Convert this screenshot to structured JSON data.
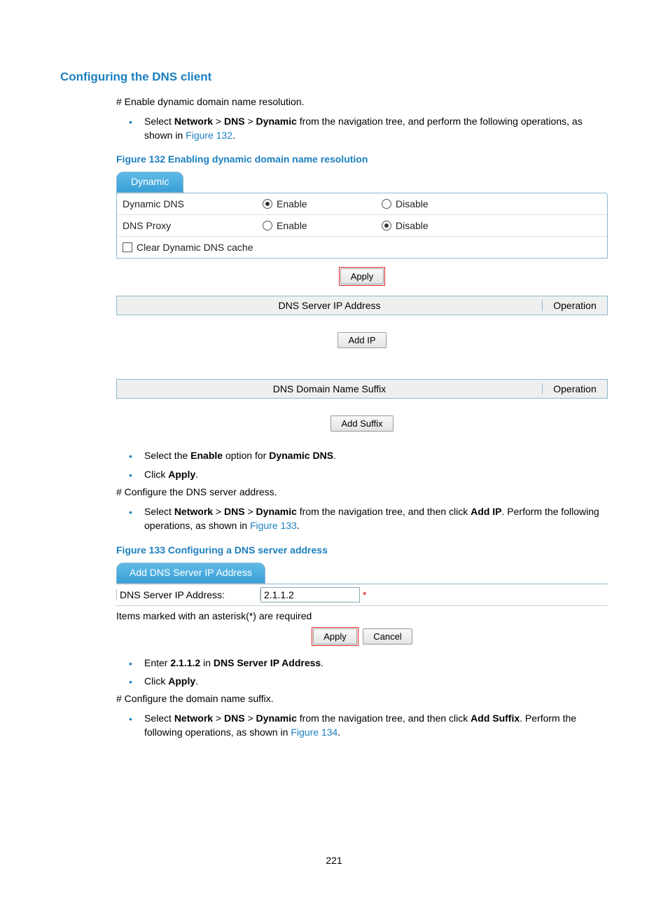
{
  "section_title": "Configuring the DNS client",
  "line1": "# Enable dynamic domain name resolution.",
  "bullet1_pre": "Select ",
  "nav_network": "Network",
  "nav_gt1": " > ",
  "nav_dns": "DNS",
  "nav_gt2": " > ",
  "nav_dynamic": "Dynamic",
  "bullet1_post": " from the navigation tree, and perform the following operations, as shown in ",
  "fig132_link": "Figure 132",
  "period": ".",
  "fig132_caption": "Figure 132 Enabling dynamic domain name resolution",
  "panel": {
    "tab": "Dynamic",
    "row1_label": "Dynamic DNS",
    "row2_label": "DNS Proxy",
    "radio_enable": "Enable",
    "radio_disable": "Disable",
    "row3_label": "Clear Dynamic DNS cache",
    "apply": "Apply",
    "hdr1": "DNS Server IP Address",
    "hdr_op": "Operation",
    "add_ip": "Add IP",
    "hdr2": "DNS Domain Name Suffix",
    "add_suffix": "Add Suffix"
  },
  "bullet2_pre": "Select the ",
  "enable_bold": "Enable",
  "bullet2_mid": " option for ",
  "dynamic_dns_bold": "Dynamic DNS",
  "bullet3_pre": "Click ",
  "apply_bold": "Apply",
  "line2": "# Configure the DNS server address.",
  "bullet4_post": " from the navigation tree, and then click ",
  "add_ip_bold": "Add IP",
  "bullet4_end": ". Perform the following operations, as shown in ",
  "fig133_link": "Figure 133",
  "fig133_caption": "Figure 133 Configuring a DNS server address",
  "fig133": {
    "tab": "Add DNS Server IP Address",
    "label": "DNS Server IP Address:",
    "value": "2.1.1.2",
    "note": "Items marked with an asterisk(*) are required",
    "apply": "Apply",
    "cancel": "Cancel"
  },
  "bullet5_pre": "Enter ",
  "ip_bold": "2.1.1.2",
  "bullet5_mid": " in ",
  "field_bold": "DNS Server IP Address",
  "line3": "# Configure the domain name suffix.",
  "add_suffix_bold": "Add Suffix",
  "bullet6_end": ". Perform the following operations, as shown in ",
  "fig134_link": "Figure 134",
  "page_number": "221"
}
